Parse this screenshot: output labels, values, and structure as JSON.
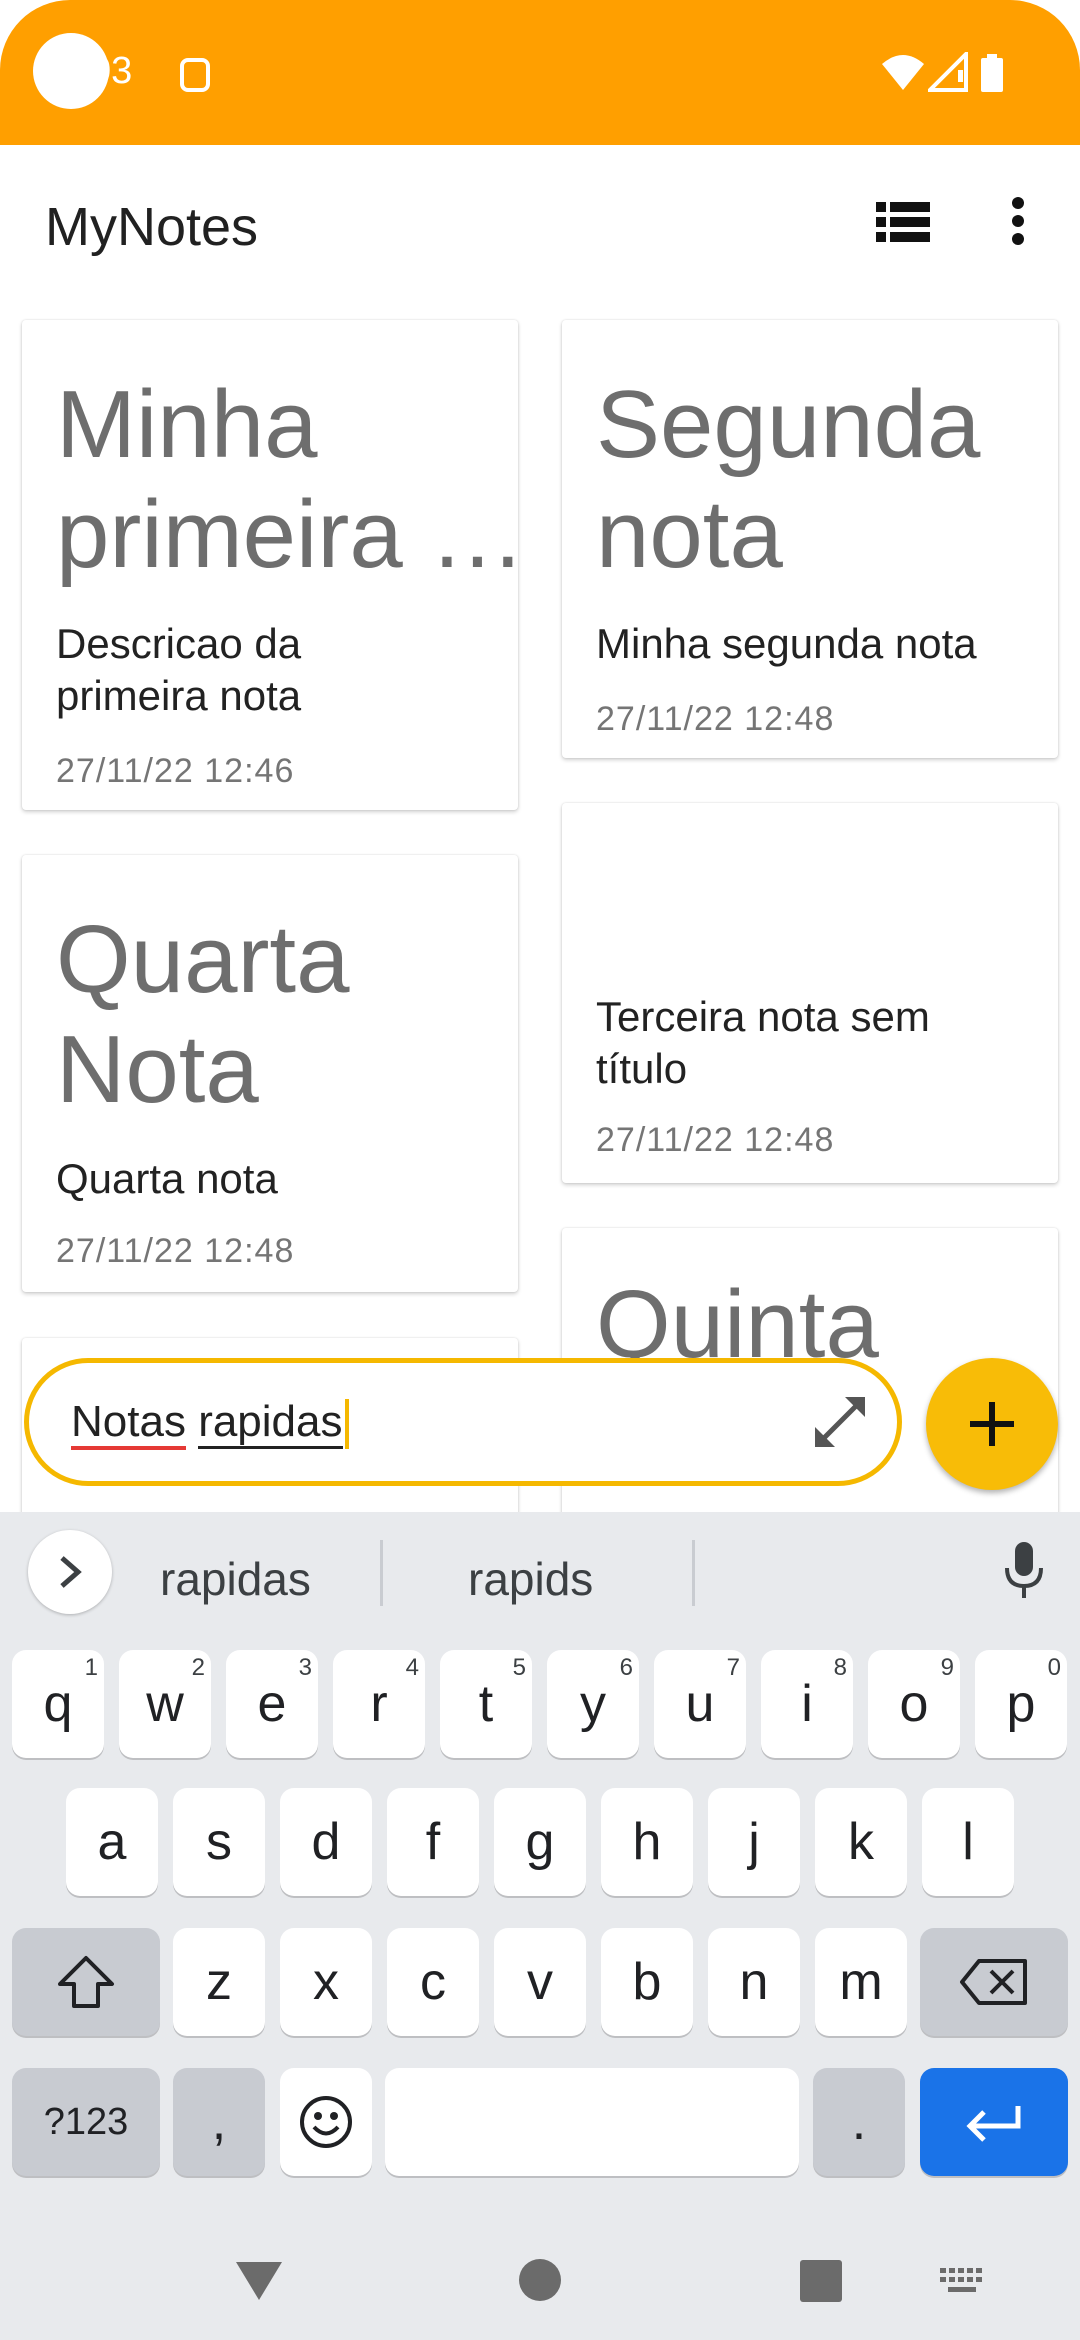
{
  "status_bar": {
    "time": "03"
  },
  "app": {
    "title": "MyNotes"
  },
  "notes": [
    {
      "title": "Minha\nprimeira …",
      "body": "Descricao da\nprimeira nota",
      "date": "27/11/22 12:46"
    },
    {
      "title": "Segunda\nnota",
      "body": "Minha segunda nota",
      "date": "27/11/22 12:48"
    },
    {
      "title": "Quarta\nNota",
      "body": "Quarta nota",
      "date": "27/11/22 12:48"
    },
    {
      "title": "",
      "body": "Terceira nota sem\ntítulo",
      "date": "27/11/22 12:48"
    },
    {
      "title": "Quinta",
      "body": "",
      "date": ""
    }
  ],
  "quick_note": {
    "word1": "Notas",
    "word2": "rapidas"
  },
  "keyboard": {
    "suggestions": [
      "rapidas",
      "rapids"
    ],
    "row1": [
      "q",
      "w",
      "e",
      "r",
      "t",
      "y",
      "u",
      "i",
      "o",
      "p"
    ],
    "row1_hints": [
      "1",
      "2",
      "3",
      "4",
      "5",
      "6",
      "7",
      "8",
      "9",
      "0"
    ],
    "row2": [
      "a",
      "s",
      "d",
      "f",
      "g",
      "h",
      "j",
      "k",
      "l"
    ],
    "row3": [
      "z",
      "x",
      "c",
      "v",
      "b",
      "n",
      "m"
    ],
    "symbols_label": "?123",
    "comma": ",",
    "period": "."
  },
  "colors": {
    "status_bar": "#ff9f00",
    "accent": "#f8bc07",
    "enter_key": "#1a73e8"
  }
}
